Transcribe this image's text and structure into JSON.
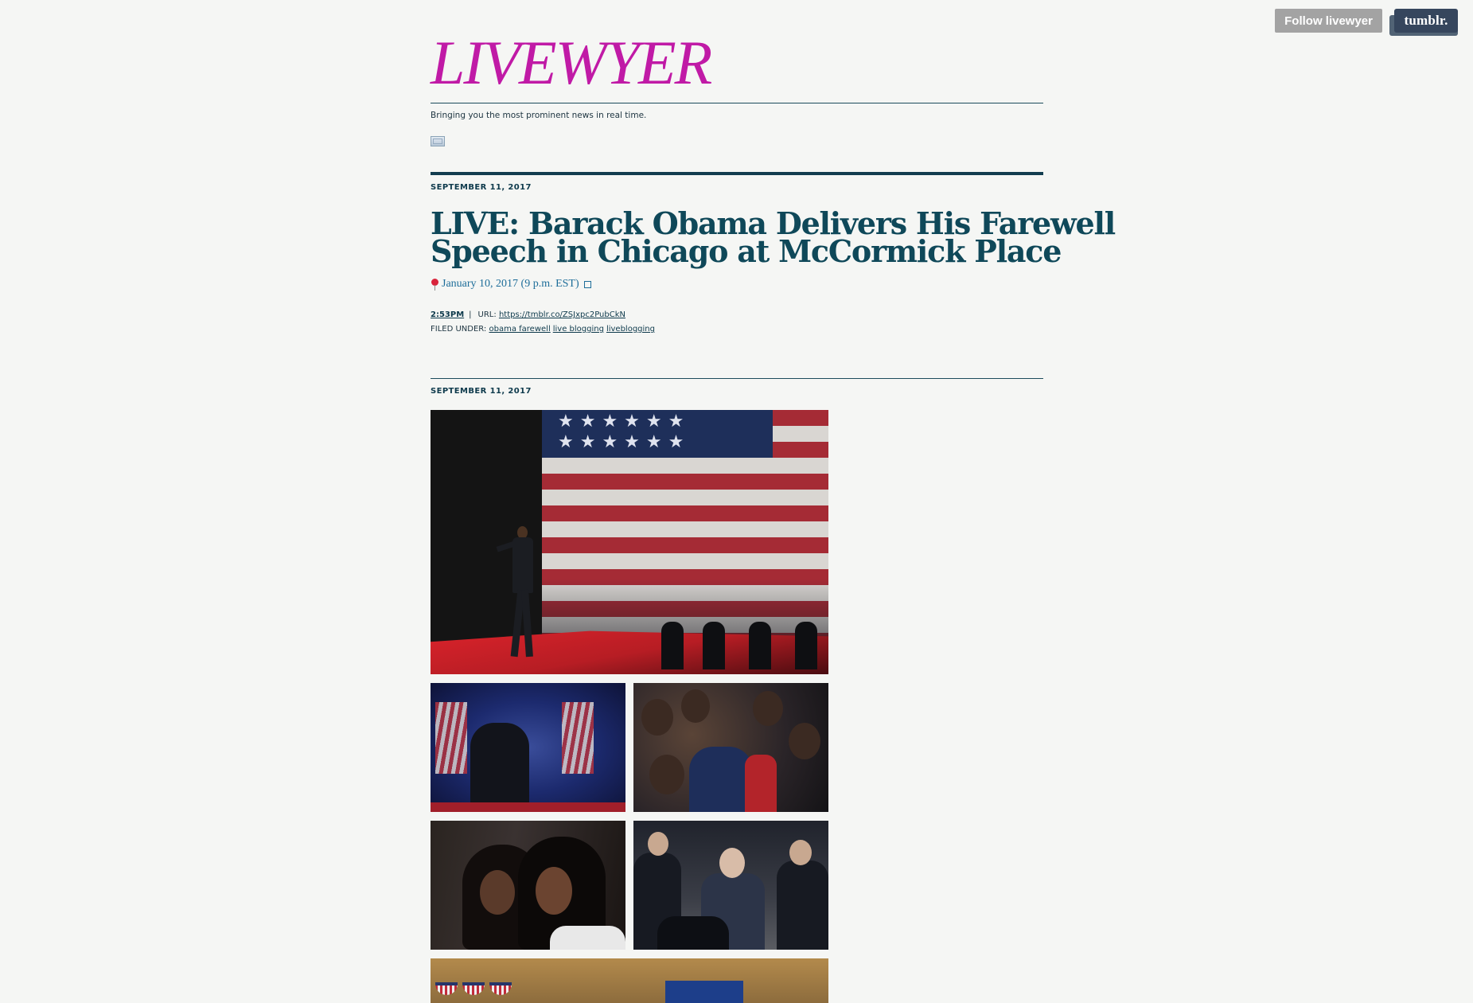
{
  "tumblr_bar": {
    "follow_label": "Follow livewyer",
    "logo_label": "tumblr."
  },
  "header": {
    "blog_title": "LIVEWYER",
    "tagline": "Bringing you the most prominent news in real time."
  },
  "posts": [
    {
      "date": "SEPTEMBER 11, 2017",
      "title_line_1": "LIVE: Barack Obama Delivers His Farewell",
      "title_line_2": "Speech in Chicago at McCormick Place",
      "body_text": "January 10, 2017 (9 p.m. EST)",
      "time": "2:53PM",
      "separator": "|",
      "url_label": "URL:",
      "url": "https://tmblr.co/ZSJxpc2PubCkN",
      "filed_label": "FILED UNDER:",
      "tags": [
        "obama farewell",
        "live blogging",
        "liveblogging"
      ]
    },
    {
      "date": "SEPTEMBER 11, 2017"
    }
  ],
  "colors": {
    "background": "#f5f6f4",
    "logo": "#c01aa6",
    "title": "#0f4859",
    "link": "#1d6d99",
    "rule": "#123d4f"
  },
  "icons": {
    "pin": "round-pushpin-icon",
    "box": "square-icon",
    "nav": "image-icon"
  }
}
